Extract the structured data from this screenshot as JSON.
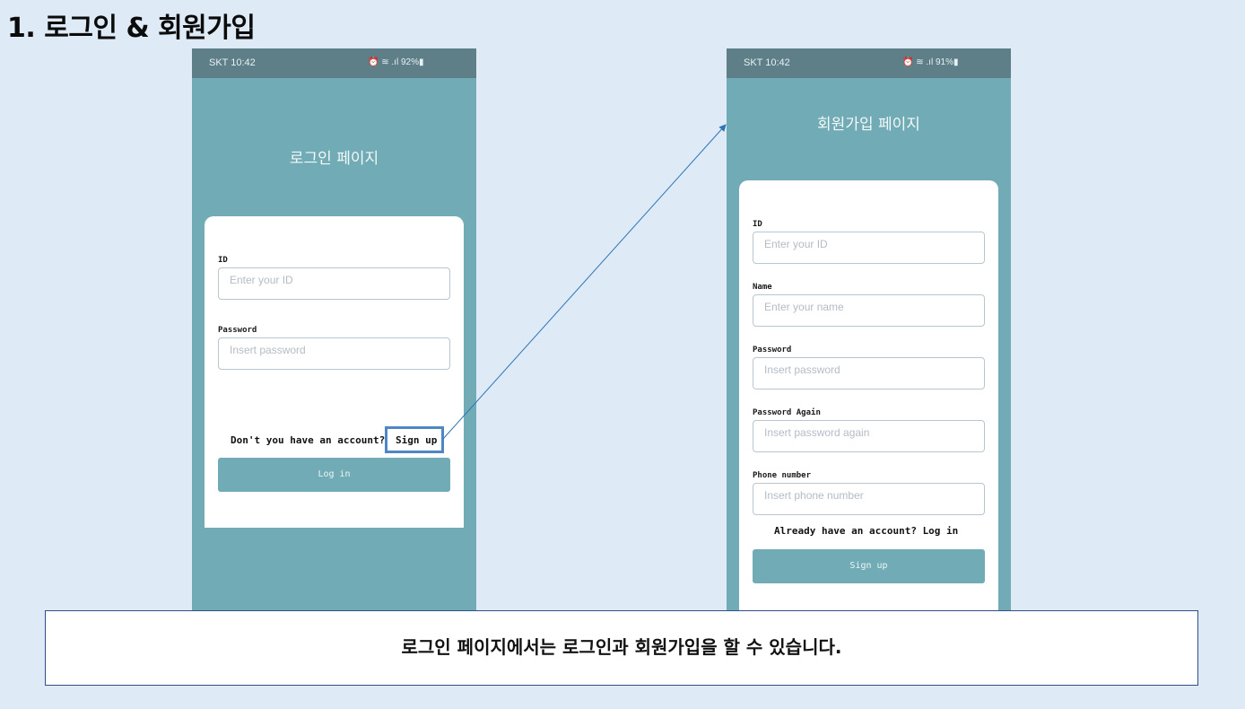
{
  "slide": {
    "title": "1. 로그인 & 회원가입",
    "caption": "로그인 페이지에서는 로그인과 회원가입을 할 수 있습니다."
  },
  "login_screen": {
    "status": {
      "carrier": "SKT 10:42",
      "indicators": "⏰ ≋ .ıl 92%▮"
    },
    "title": "로그인 페이지",
    "id_label": "ID",
    "id_placeholder": "Enter your ID",
    "password_label": "Password",
    "password_placeholder": "Insert password",
    "signup_prompt": "Don't you have an account?",
    "signup_link": "Sign up",
    "login_button": "Log in"
  },
  "signup_screen": {
    "status": {
      "carrier": "SKT 10:42",
      "indicators": "⏰ ≋ .ıl 91%▮"
    },
    "title": "회원가입 페이지",
    "id_label": "ID",
    "id_placeholder": "Enter your ID",
    "name_label": "Name",
    "name_placeholder": "Enter your name",
    "password_label": "Password",
    "password_placeholder": "Insert password",
    "password_again_label": "Password Again",
    "password_again_placeholder": "Insert password again",
    "phone_label": "Phone number",
    "phone_placeholder": "Insert phone number",
    "login_prompt": "Already have an account? Log in",
    "signup_button": "Sign up"
  },
  "colors": {
    "background": "#deeaf6",
    "app_teal": "#71abb5",
    "status_bar": "#5e7f88",
    "highlight": "#4f86c6",
    "arrow": "#2e75b6"
  }
}
